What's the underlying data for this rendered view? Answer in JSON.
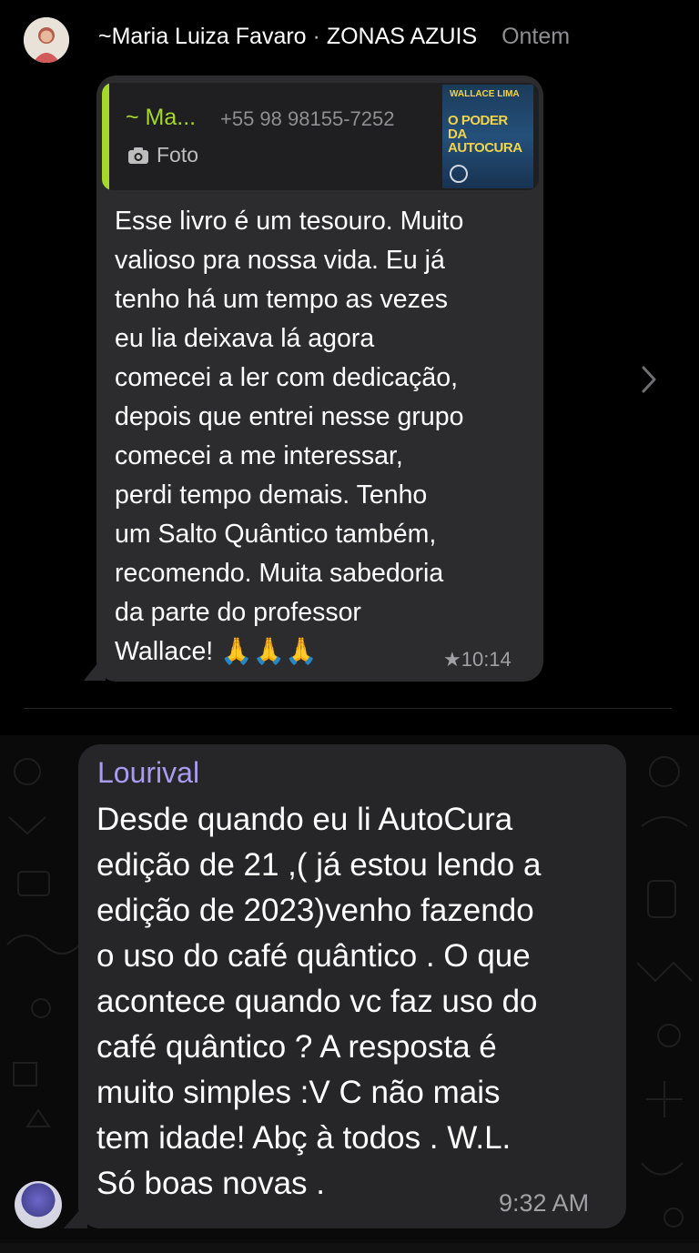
{
  "top_chat": {
    "header": {
      "sender": "~Maria Luiza Favaro",
      "separator": "·",
      "group": "ZONAS AZUIS",
      "time": "Ontem"
    },
    "quoted": {
      "sender": "~ Ma...",
      "phone": "+55 98 98155-7252",
      "type_label": "Foto",
      "thumbnail_author": "WALLACE LIMA",
      "thumbnail_title": "O PODER DA AUTOCURA"
    },
    "message_lines": [
      "Esse livro é um tesouro. Muito",
      "valioso pra nossa vida. Eu já",
      "tenho há um tempo as vezes",
      "eu lia deixava lá agora",
      "comecei  a ler com dedicação,",
      "depois que entrei nesse grupo",
      "comecei a me interessar,",
      "perdi tempo demais. Tenho",
      "um Salto Quântico também,",
      "recomendo. Muita sabedoria",
      "da parte do professor",
      "Wallace! 🙏🙏🙏"
    ],
    "meta": "★10:14"
  },
  "bottom_chat": {
    "sender": "Lourival",
    "message_lines": [
      "Desde quando eu li AutoCura",
      "edição de 21 ,( já estou lendo a",
      "edição de 2023)venho fazendo",
      "o uso do café quântico . O que",
      "acontece quando vc faz uso do",
      "café quântico ? A resposta é",
      "muito simples :V C não mais",
      "tem idade! Abç à todos . W.L.",
      "Só boas novas ."
    ],
    "time": "9:32 AM"
  },
  "colors": {
    "quote_accent": "#a6d82a",
    "bubble": "#2c2c2e",
    "sender_name_bottom": "#a99cf0",
    "meta_text": "#a0a0a5"
  },
  "icons": [
    "camera-icon",
    "chevron-right-icon"
  ]
}
